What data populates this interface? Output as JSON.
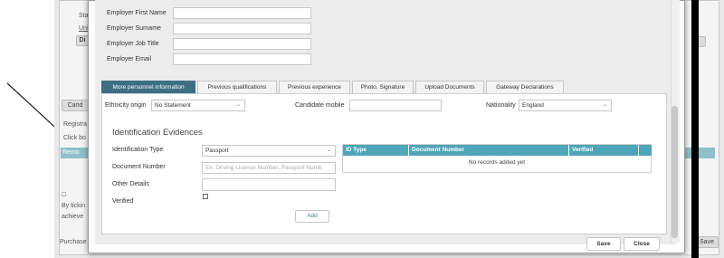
{
  "background": {
    "stat_label": "Stat",
    "link1": "Unit",
    "btn1": "Di",
    "tab_cand": "Cand",
    "registra_label": "Registra",
    "click_label": "Click bo",
    "teal_row": "Remo",
    "by_tick": "By tickin",
    "achieve": "achieve",
    "purchase": "Purchase",
    "save_right": "Save"
  },
  "employer": {
    "first_name_label": "Employer First Name",
    "surname_label": "Employer Surname",
    "job_title_label": "Employer Job Title",
    "email_label": "Employer Email"
  },
  "tabs": [
    {
      "label": "More personnel information"
    },
    {
      "label": "Previous qualifications"
    },
    {
      "label": "Previous experience"
    },
    {
      "label": "Photo, Signature"
    },
    {
      "label": "Upload Documents"
    },
    {
      "label": "Gateway Declarations"
    }
  ],
  "personal": {
    "ethnicity_label": "Ethnicity origin",
    "ethnicity_value": "No Statement",
    "mobile_label": "Candidate mobile",
    "mobile_value": "",
    "nationality_label": "Nationality",
    "nationality_value": "England"
  },
  "evidence": {
    "heading": "Identification Evidences",
    "id_type_label": "Identification Type",
    "id_type_value": "Passport",
    "doc_number_label": "Document Number",
    "doc_number_placeholder": "Ex: Driving License Number, Passport Numb",
    "other_details_label": "Other Details",
    "verified_label": "Verified",
    "add_button": "Add",
    "table_headers": [
      "ID Type",
      "Document Number",
      "Verified"
    ],
    "empty_message": "No records added yet"
  },
  "footer": {
    "save_button": "Save",
    "close_button": "Close"
  },
  "colors": {
    "tab_active": "#3d6f84",
    "table_header": "#4fa6b8"
  }
}
